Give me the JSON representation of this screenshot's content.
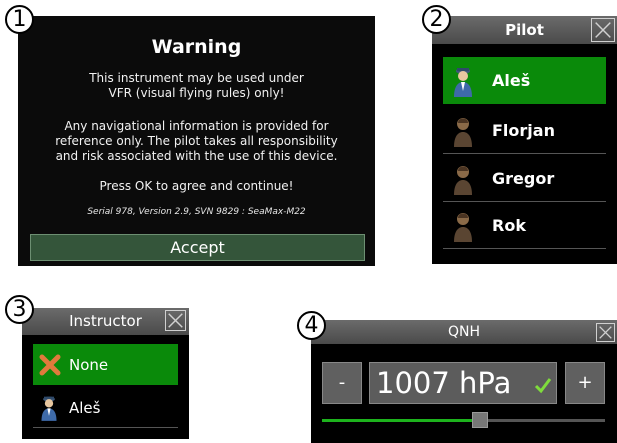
{
  "badges": [
    "1",
    "2",
    "3",
    "4"
  ],
  "warning": {
    "title": "Warning",
    "line1": "This instrument may be used under",
    "line2": "VFR (visual flying rules) only!",
    "line3": "Any navigational information is provided for",
    "line4": "reference only. The pilot takes all responsibility",
    "line5": "and risk associated with the use of this device.",
    "line6": "Press OK to agree and continue!",
    "serial": "Serial 978, Version 2.9, SVN 9829 : SeaMax-M22",
    "accept_label": "Accept"
  },
  "pilot": {
    "title": "Pilot",
    "items": [
      {
        "label": "Aleš",
        "selected": true,
        "icon": "pilot-avatar-icon"
      },
      {
        "label": "Florjan",
        "selected": false,
        "icon": "person-avatar-icon"
      },
      {
        "label": "Gregor",
        "selected": false,
        "icon": "person-avatar-icon"
      },
      {
        "label": "Rok",
        "selected": false,
        "icon": "person-avatar-icon"
      }
    ]
  },
  "instructor": {
    "title": "Instructor",
    "items": [
      {
        "label": "None",
        "selected": true,
        "icon": "x-mark-icon"
      },
      {
        "label": "Aleš",
        "selected": false,
        "icon": "pilot-avatar-icon"
      }
    ]
  },
  "qnh": {
    "title": "QNH",
    "minus_label": "-",
    "plus_label": "+",
    "value": "1007 hPa",
    "slider_position": 0.56
  },
  "colors": {
    "selected_green": "#0a8a0a",
    "accept_bg": "#34553a",
    "slider_track": "#1db31d",
    "check": "#7fdc3c"
  }
}
